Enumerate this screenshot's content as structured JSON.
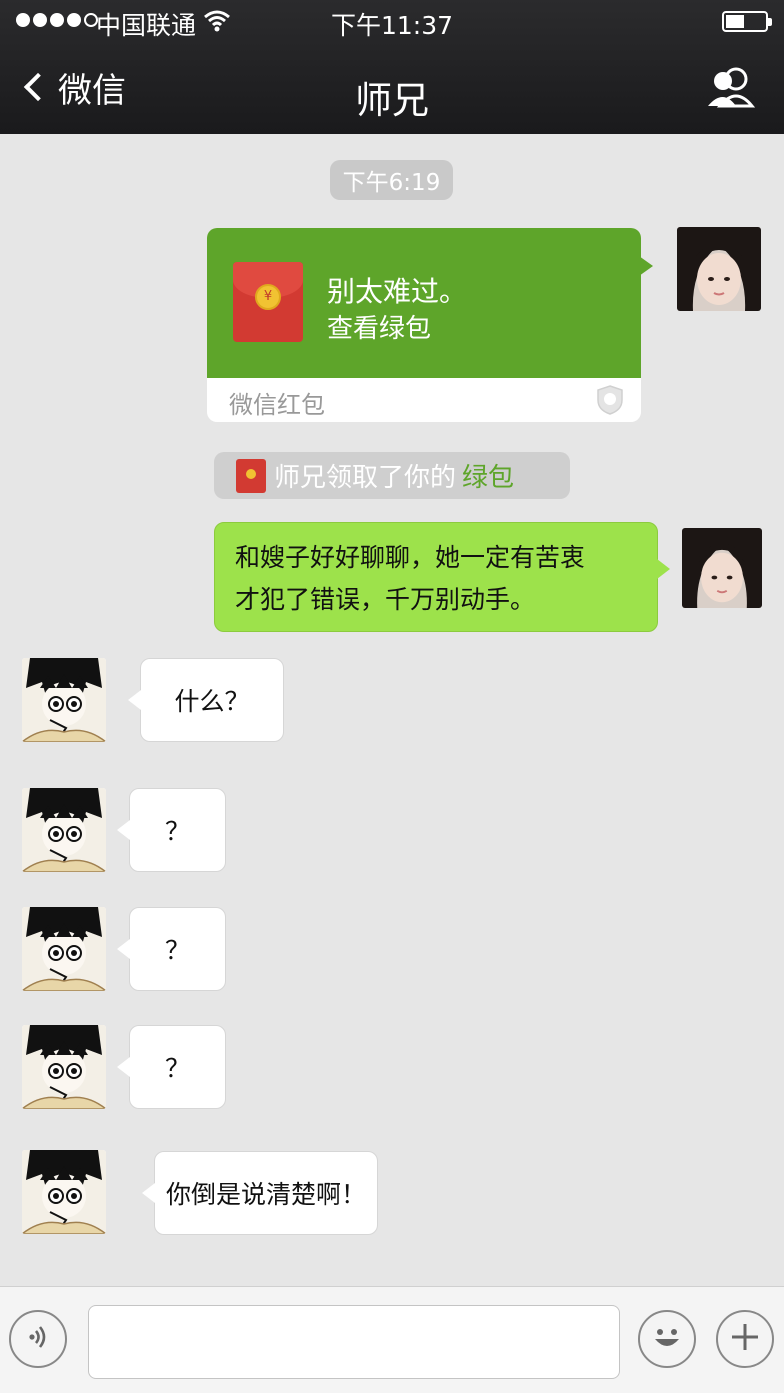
{
  "status_bar": {
    "carrier": "中国联通",
    "time": "下午11:37",
    "signal_bars": 4,
    "signal_max": 5
  },
  "nav": {
    "back_label": "微信",
    "title": "师兄"
  },
  "chat": {
    "timestamp": "下午6:19",
    "red_packet": {
      "line1": "别太难过。",
      "line2": "查看绿包",
      "footer": "微信红包",
      "coin_symbol": "¥"
    },
    "notice": {
      "text": "师兄领取了你的",
      "highlight": "绿包"
    },
    "messages": [
      {
        "side": "right",
        "lines": [
          "和嫂子好好聊聊，她一定有苦衷",
          "才犯了错误，千万别动手。"
        ]
      },
      {
        "side": "left",
        "text": "什么？"
      },
      {
        "side": "left",
        "text": "？"
      },
      {
        "side": "left",
        "text": "？"
      },
      {
        "side": "left",
        "text": "？"
      },
      {
        "side": "left",
        "text": "你倒是说清楚啊！"
      }
    ]
  },
  "input": {
    "value": "",
    "voice_icon": "voice-icon",
    "emoji_icon": "emoji-icon",
    "plus_icon": "plus-icon"
  },
  "colors": {
    "nav_bg": "#1f1f21",
    "chat_bg": "#e6e6e6",
    "my_bubble": "#9de24b",
    "packet_green": "#5ea52a",
    "notice_green": "#5ea52a"
  }
}
